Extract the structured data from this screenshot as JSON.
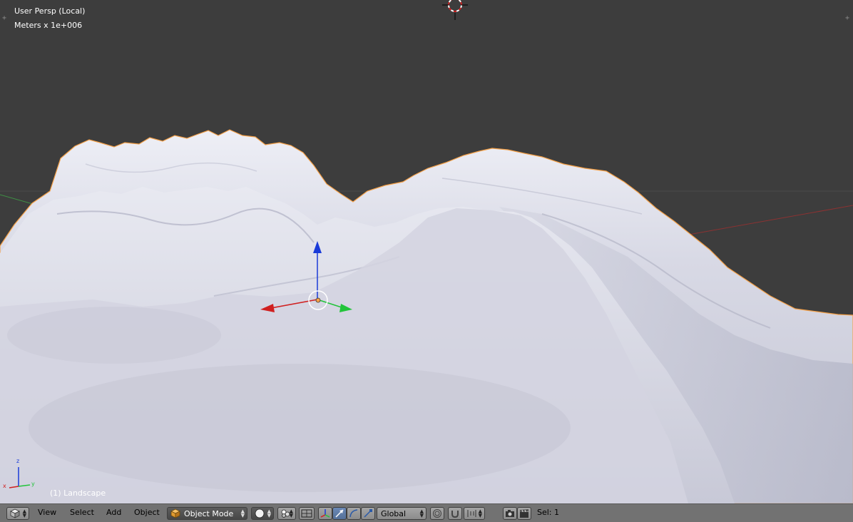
{
  "viewport": {
    "view_name": "User Persp (Local)",
    "units": "Meters x 1e+006",
    "active_object": "(1) Landscape",
    "mini_axes": {
      "z": "z",
      "y": "y",
      "x": "x"
    }
  },
  "header": {
    "editor_type_icon": "cube-icon",
    "menus": [
      "View",
      "Select",
      "Add",
      "Object"
    ],
    "mode": "Object Mode",
    "shading_icon": "solid-sphere-icon",
    "pivot_icon": "pivot-point-icon",
    "orientation": "Global",
    "selection_info": "Sel: 1"
  },
  "colors": {
    "viewport_bg": "#3d3d3d",
    "terrain": "#c9cad8",
    "selection_outline": "#f5a148",
    "axis_x": "#d02020",
    "axis_y": "#22c43a",
    "axis_z": "#1a3bd8",
    "header_bg": "#727272",
    "active_button": "#5680c2"
  }
}
